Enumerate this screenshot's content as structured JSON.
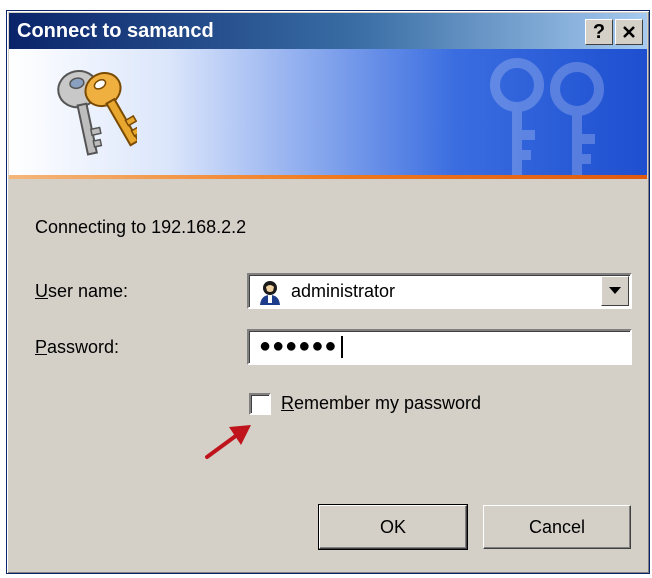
{
  "window": {
    "title": "Connect to samancd",
    "help_button": "?",
    "close_button": "✕"
  },
  "dialog": {
    "connecting_text": "Connecting to 192.168.2.2",
    "user_label_mnemonic": "U",
    "user_label_rest": "ser name:",
    "user_value": "administrator",
    "password_label_mnemonic": "P",
    "password_label_rest": "assword:",
    "password_mask": "●●●●●●",
    "remember_mnemonic": "R",
    "remember_rest": "emember my password",
    "remember_checked": false,
    "ok_label": "OK",
    "cancel_label": "Cancel"
  },
  "icons": {
    "keys": "keys-icon",
    "user": "user-account-icon",
    "dropdown": "chevron-down-icon",
    "annotation_arrow": "red-arrow-icon"
  },
  "colors": {
    "titlebar_start": "#0a246a",
    "titlebar_end": "#a6caf0",
    "dialog_bg": "#d4d0c8",
    "banner_accent": "#f07a20",
    "arrow": "#c0141c"
  }
}
